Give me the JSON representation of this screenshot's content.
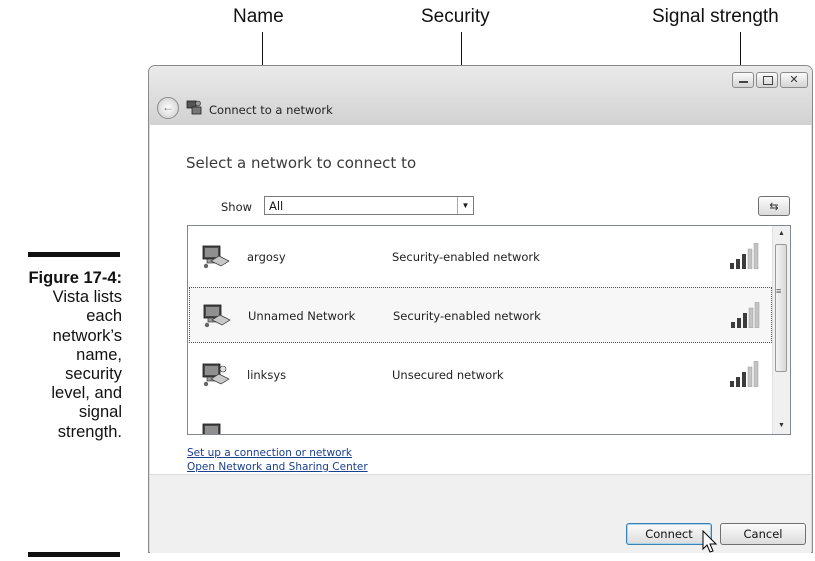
{
  "callouts": {
    "name": "Name",
    "security": "Security",
    "signal": "Signal strength"
  },
  "caption": {
    "figure": "Figure 17-4:",
    "lines": [
      "Vista lists",
      "each",
      "network’s",
      "name,",
      "security",
      "level, and",
      "signal",
      "strength."
    ]
  },
  "window": {
    "title": "Connect to a network",
    "heading": "Select a network to connect to",
    "show_label": "Show",
    "show_value": "All"
  },
  "networks": [
    {
      "name": "argosy",
      "security": "Security-enabled network",
      "signal_bars": 5,
      "selected": false
    },
    {
      "name": "Unnamed Network",
      "security": "Security-enabled network",
      "signal_bars": 5,
      "selected": true
    },
    {
      "name": "linksys",
      "security": "Unsecured network",
      "signal_bars": 5,
      "selected": false
    }
  ],
  "links": {
    "setup": "Set up a connection or network",
    "sharing_center": "Open Network and Sharing Center"
  },
  "buttons": {
    "connect": "Connect",
    "cancel": "Cancel"
  },
  "colors": {
    "link": "#1a3f8f",
    "signal_on": "#3c3c3c",
    "signal_off": "#c4c4c4"
  },
  "icons": [
    "back-arrow-icon",
    "network-icon",
    "refresh-icon",
    "minimize-icon",
    "maximize-icon",
    "close-icon",
    "computer-network-icon",
    "signal-strength-icon",
    "mouse-cursor-icon"
  ]
}
